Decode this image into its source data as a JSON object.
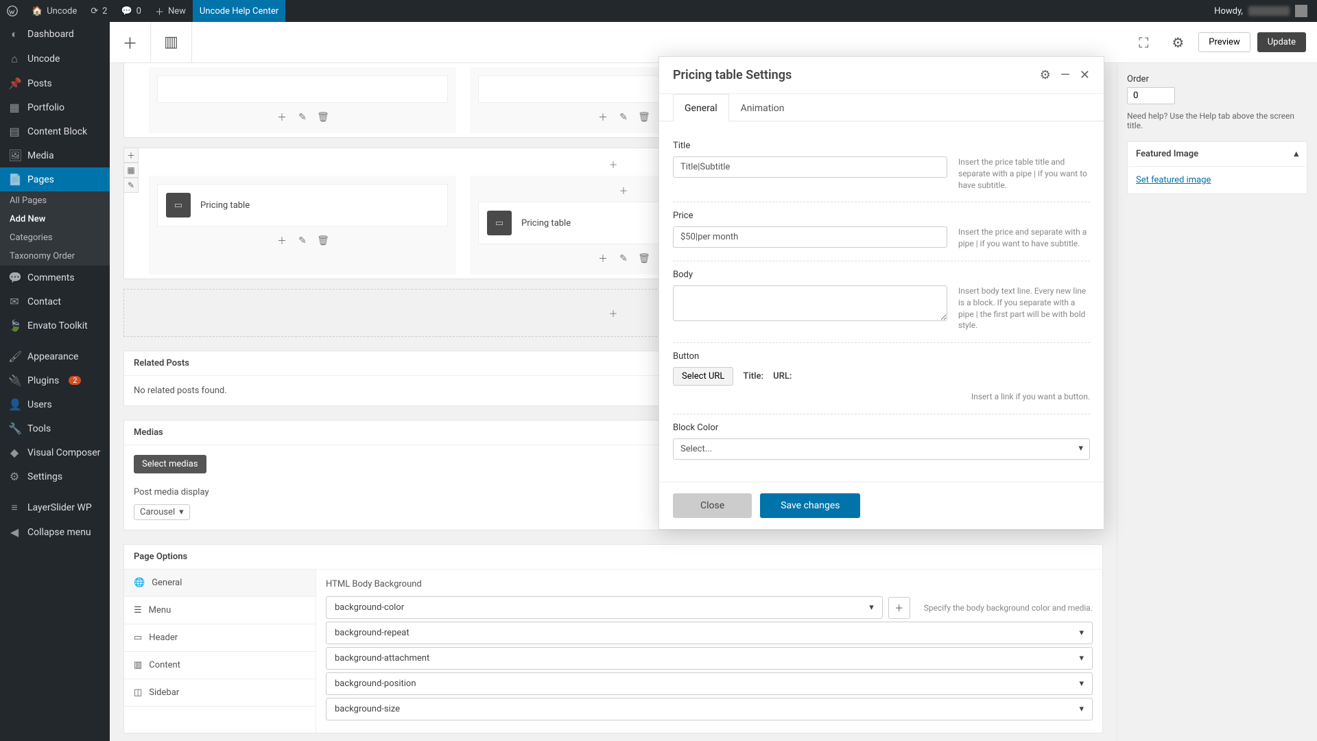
{
  "adminbar": {
    "siteName": "Uncode",
    "updateCount": "2",
    "commentCount": "0",
    "newLabel": "New",
    "helpCenter": "Uncode Help Center",
    "howdy": "Howdy,"
  },
  "sidebar": {
    "items": [
      {
        "label": "Dashboard",
        "icon": "dashboard"
      },
      {
        "label": "Uncode",
        "icon": "home"
      },
      {
        "label": "Posts",
        "icon": "pin"
      },
      {
        "label": "Portfolio",
        "icon": "grid"
      },
      {
        "label": "Content Block",
        "icon": "grid2"
      },
      {
        "label": "Media",
        "icon": "media"
      },
      {
        "label": "Pages",
        "icon": "pages"
      },
      {
        "label": "Comments",
        "icon": "comment"
      },
      {
        "label": "Contact",
        "icon": "mail"
      },
      {
        "label": "Envato Toolkit",
        "icon": "envato"
      },
      {
        "label": "Appearance",
        "icon": "brush"
      },
      {
        "label": "Plugins",
        "icon": "plugin"
      },
      {
        "label": "Users",
        "icon": "user"
      },
      {
        "label": "Tools",
        "icon": "wrench"
      },
      {
        "label": "Visual Composer",
        "icon": "vc"
      },
      {
        "label": "Settings",
        "icon": "gear"
      },
      {
        "label": "LayerSlider WP",
        "icon": "layers"
      },
      {
        "label": "Collapse menu",
        "icon": "collapse"
      }
    ],
    "pagesSub": [
      "All Pages",
      "Add New",
      "Categories",
      "Taxonomy Order"
    ],
    "pluginsBadge": "2"
  },
  "toolbar": {
    "previewLabel": "Preview",
    "updateLabel": "Update"
  },
  "canvas": {
    "pricingCardLabel": "Pricing table",
    "relatedPostsTitle": "Related Posts",
    "relatedPostsEmpty": "No related posts found.",
    "mediasTitle": "Medias",
    "selectMediasLabel": "Select medias",
    "postMediaDisplayLabel": "Post media display",
    "postMediaDisplayValue": "Carousel",
    "pageOptionsTitle": "Page Options",
    "poTabs": [
      "General",
      "Menu",
      "Header",
      "Content",
      "Sidebar"
    ],
    "poBodyLabel": "HTML Body Background",
    "poAccordions": [
      "background-color",
      "background-repeat",
      "background-attachment",
      "background-position",
      "background-size"
    ],
    "poHint": "Specify the body background color and media."
  },
  "rightbar": {
    "orderLabel": "Order",
    "orderValue": "0",
    "helpText": "Need help? Use the Help tab above the screen title.",
    "featuredImageTitle": "Featured Image",
    "setFeaturedLink": "Set featured image"
  },
  "modal": {
    "title": "Pricing table Settings",
    "tabs": [
      "General",
      "Animation"
    ],
    "fields": {
      "titleLabel": "Title",
      "titleValue": "Title|Subtitle",
      "titleHint": "Insert the price table title and separate with a pipe | if you want to have subtitle.",
      "priceLabel": "Price",
      "priceValue": "$50|per month",
      "priceHint": "Insert the price and separate with a pipe | if you want to have subtitle.",
      "bodyLabel": "Body",
      "bodyHint": "Insert body text line. Every new line is a block. If you separate with a pipe | the first part will be with bold style.",
      "buttonLabel": "Button",
      "selectUrlLabel": "Select URL",
      "urlTitleLabel": "Title:",
      "urlUrlLabel": "URL:",
      "buttonHint": "Insert a link if you want a button.",
      "blockColorLabel": "Block Color",
      "blockColorValue": "Select..."
    },
    "closeLabel": "Close",
    "saveLabel": "Save changes"
  }
}
